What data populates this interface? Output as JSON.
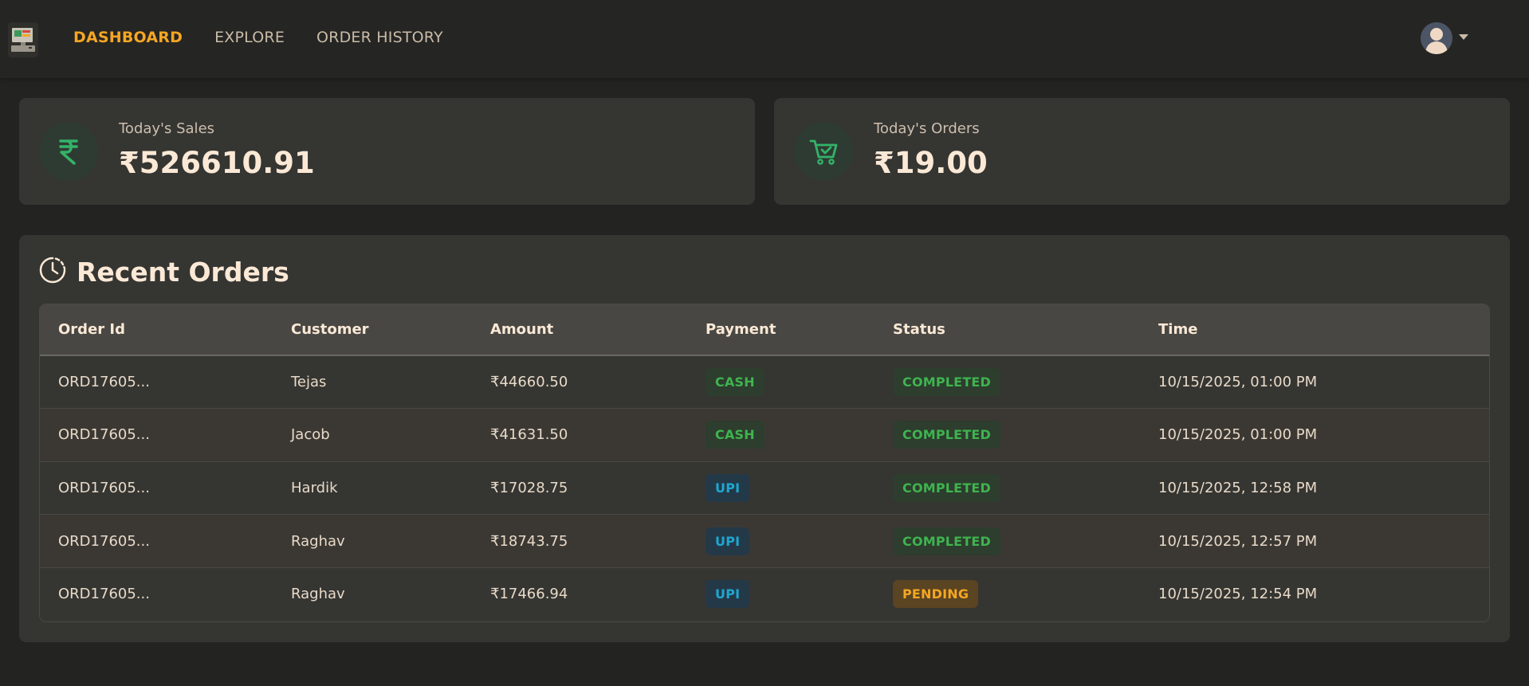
{
  "nav": {
    "links": [
      {
        "label": "DASHBOARD",
        "active": true
      },
      {
        "label": "EXPLORE",
        "active": false
      },
      {
        "label": "ORDER HISTORY",
        "active": false
      }
    ],
    "logo_icon": "pos-terminal-icon",
    "avatar_icon": "user-avatar-icon"
  },
  "stats": {
    "sales": {
      "label": "Today's Sales",
      "value": "₹526610.91",
      "icon": "rupee-icon"
    },
    "orders": {
      "label": "Today's Orders",
      "value": "₹19.00",
      "icon": "cart-check-icon"
    }
  },
  "recent_orders": {
    "title": "Recent Orders",
    "icon": "clock-icon",
    "columns": [
      "Order Id",
      "Customer",
      "Amount",
      "Payment",
      "Status",
      "Time"
    ],
    "rows": [
      {
        "order_id": "ORD17605...",
        "customer": "Tejas",
        "amount": "₹44660.50",
        "payment": "CASH",
        "status": "COMPLETED",
        "time": "10/15/2025, 01:00 PM"
      },
      {
        "order_id": "ORD17605...",
        "customer": "Jacob",
        "amount": "₹41631.50",
        "payment": "CASH",
        "status": "COMPLETED",
        "time": "10/15/2025, 01:00 PM"
      },
      {
        "order_id": "ORD17605...",
        "customer": "Hardik",
        "amount": "₹17028.75",
        "payment": "UPI",
        "status": "COMPLETED",
        "time": "10/15/2025, 12:58 PM"
      },
      {
        "order_id": "ORD17605...",
        "customer": "Raghav",
        "amount": "₹18743.75",
        "payment": "UPI",
        "status": "COMPLETED",
        "time": "10/15/2025, 12:57 PM"
      },
      {
        "order_id": "ORD17605...",
        "customer": "Raghav",
        "amount": "₹17466.94",
        "payment": "UPI",
        "status": "PENDING",
        "time": "10/15/2025, 12:54 PM"
      }
    ]
  },
  "colors": {
    "accent": "#f5a623",
    "success": "#3fb34f",
    "info": "#1ea7d1",
    "background": "#232321",
    "card": "#353532"
  }
}
